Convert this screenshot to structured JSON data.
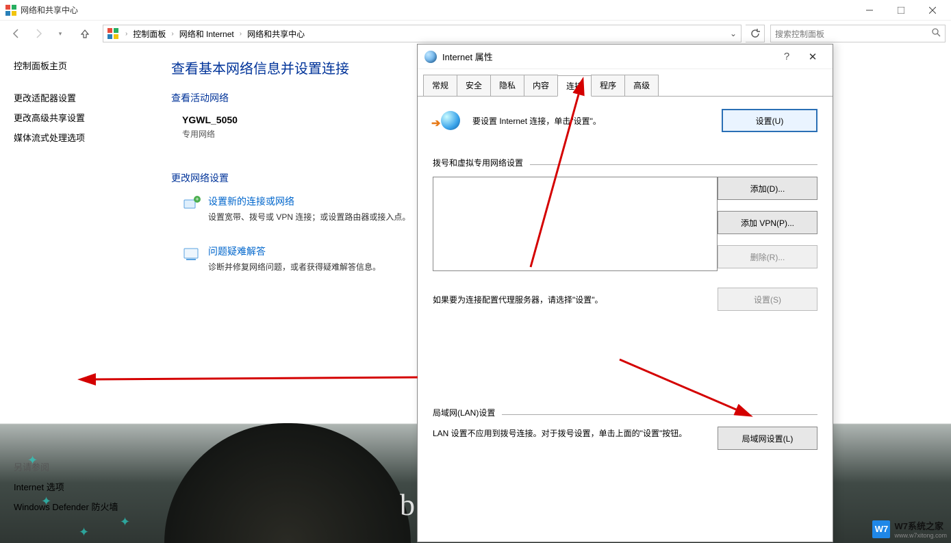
{
  "window": {
    "title": "网络和共享中心"
  },
  "breadcrumb": {
    "items": [
      "控制面板",
      "网络和 Internet",
      "网络和共享中心"
    ]
  },
  "search": {
    "placeholder": "搜索控制面板"
  },
  "sidebar": {
    "home": "控制面板主页",
    "links": [
      "更改适配器设置",
      "更改高级共享设置",
      "媒体流式处理选项"
    ],
    "see_also_label": "另请参阅",
    "internet_options": "Internet 选项",
    "defender": "Windows Defender 防火墙"
  },
  "content": {
    "heading": "查看基本网络信息并设置连接",
    "active_networks_label": "查看活动网络",
    "network_name": "YGWL_5050",
    "network_type": "专用网络",
    "change_settings_label": "更改网络设置",
    "task1_link": "设置新的连接或网络",
    "task1_desc": "设置宽带、拨号或 VPN 连接；或设置路由器或接入点。",
    "task2_link": "问题疑难解答",
    "task2_desc": "诊断并修复网络问题，或者获得疑难解答信息。"
  },
  "dialog": {
    "title": "Internet 属性",
    "tabs": [
      "常规",
      "安全",
      "隐私",
      "内容",
      "连接",
      "程序",
      "高级"
    ],
    "setup_text": "要设置 Internet 连接，单击\"设置\"。",
    "btn_setup": "设置(U)",
    "group_dialup": "拨号和虚拟专用网络设置",
    "btn_add": "添加(D)...",
    "btn_add_vpn": "添加 VPN(P)...",
    "btn_remove": "删除(R)...",
    "proxy_text": "如果要为连接配置代理服务器，请选择\"设置\"。",
    "btn_settings": "设置(S)",
    "group_lan": "局域网(LAN)设置",
    "lan_text": "LAN 设置不应用到拨号连接。对于拨号设置，单击上面的\"设置\"按钮。",
    "btn_lan": "局域网设置(L)"
  },
  "watermark": {
    "brand": "W7系统之家",
    "url": "www.w7xitong.com",
    "badge": "W7"
  }
}
